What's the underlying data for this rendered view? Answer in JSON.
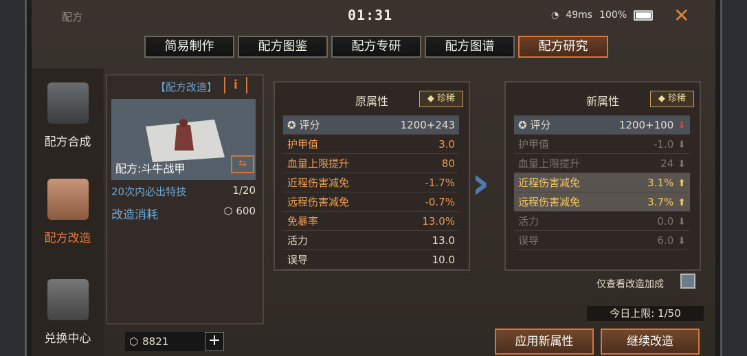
{
  "window": {
    "title": "配方",
    "clock": "01:31",
    "ping": "49ms",
    "battery": "100%"
  },
  "tabs": [
    "简易制作",
    "配方图鉴",
    "配方专研",
    "配方图谱",
    "配方研究"
  ],
  "sidebar": [
    {
      "label": "配方合成",
      "icon": "printer-icon"
    },
    {
      "label": "配方改造",
      "icon": "blueprint-edit-icon"
    },
    {
      "label": "兑换中心",
      "icon": "shopping-bag-icon"
    }
  ],
  "left_panel": {
    "header": "【配方改造】",
    "recipe_name": "配方:斗牛战甲",
    "guarantee_label": "20次内必出特技",
    "guarantee_progress": "1/20",
    "cost_label": "改造消耗",
    "cost_value": "600"
  },
  "original": {
    "title": "原属性",
    "rarity": "珍稀",
    "rows": [
      {
        "label": "评分",
        "value": "1200+243"
      },
      {
        "label": "护甲值",
        "value": "3.0"
      },
      {
        "label": "血量上限提升",
        "value": "80"
      },
      {
        "label": "近程伤害减免",
        "value": "-1.7%"
      },
      {
        "label": "远程伤害减免",
        "value": "-0.7%"
      },
      {
        "label": "免暴率",
        "value": "13.0%"
      },
      {
        "label": "活力",
        "value": "13.0"
      },
      {
        "label": "误导",
        "value": "10.0"
      }
    ]
  },
  "new": {
    "title": "新属性",
    "rarity": "珍稀",
    "rows": [
      {
        "label": "评分",
        "value": "1200+100",
        "trend": "down"
      },
      {
        "label": "护甲值",
        "value": "-1.0",
        "trend": "down"
      },
      {
        "label": "血量上限提升",
        "value": "24",
        "trend": "down"
      },
      {
        "label": "近程伤害减免",
        "value": "3.1%",
        "trend": "up"
      },
      {
        "label": "远程伤害减免",
        "value": "3.7%",
        "trend": "up"
      },
      {
        "label": "活力",
        "value": "0.0",
        "trend": "down"
      },
      {
        "label": "误导",
        "value": "6.0",
        "trend": "down"
      }
    ]
  },
  "controls": {
    "filter_label": "仅查看改造加成",
    "daily_limit": "今日上限: 1/50",
    "apply_button": "应用新属性",
    "continue_button": "继续改造",
    "currency_amount": "8821"
  }
}
